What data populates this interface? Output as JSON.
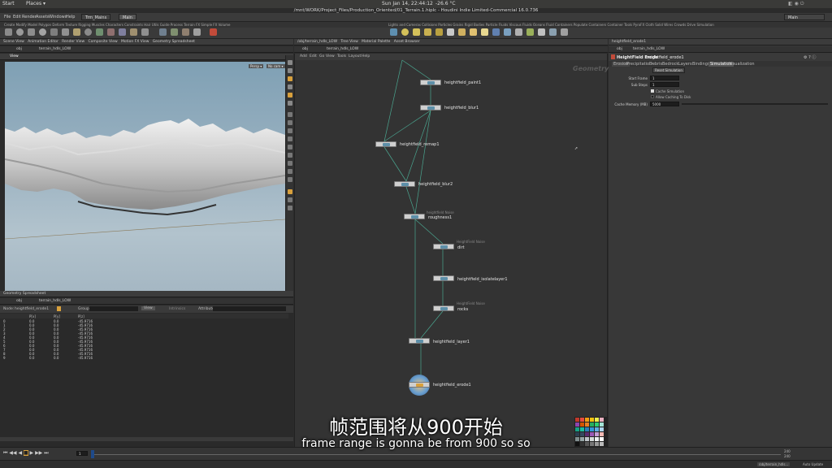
{
  "system": {
    "start": "Start",
    "places": "Places ▾",
    "datetime": "Sun Jan 14, 22:44:12",
    "temp": "-26.6 °C"
  },
  "window": {
    "title": "/mnt/WORK/Project_Files/Production_Oriented/01_Terrain.1.hiplc - Houdini Indie Limited-Commercial 16.0.736"
  },
  "menu": [
    "File",
    "Edit",
    "Render",
    "Assets",
    "Windows",
    "Help"
  ],
  "desktop_tabs": [
    "Trm_Mains",
    "Main"
  ],
  "desktop_right": "Main",
  "network_path": "obj",
  "network_node": "terrain_hdls_LOW",
  "network_menu": [
    "Add",
    "Edit",
    "Go",
    "View",
    "Tools",
    "Layout",
    "Help"
  ],
  "network_context": "Geometry",
  "viewport": {
    "tab": "View",
    "path": "obj",
    "node": "terrain_hdls_LOW",
    "persp": "Persp ▾",
    "cam": "No cam ▾"
  },
  "nodes": [
    {
      "name": "heightfield_paint1",
      "type": ""
    },
    {
      "name": "heightfield_blur1",
      "type": ""
    },
    {
      "name": "heightfield_remap1",
      "type": ""
    },
    {
      "name": "heightfield_blur2",
      "type": ""
    },
    {
      "name": "roughness1",
      "type": "heightfield Noise"
    },
    {
      "name": "dirt",
      "type": "HeightField Noise"
    },
    {
      "name": "heightfield_isolatelayer1",
      "type": ""
    },
    {
      "name": "rocks",
      "type": "HeightField Noise"
    },
    {
      "name": "heightfield_layer1",
      "type": ""
    },
    {
      "name": "heightfield_erode1",
      "type": ""
    }
  ],
  "params": {
    "path": "obj",
    "node_path": "terrain_hdls_LOW",
    "node_type": "HeightField Erode",
    "node_name": "heightfield_erode1",
    "tabs": [
      "Erosion",
      "Precipitation",
      "Debris",
      "Bedrock",
      "Layers",
      "Bindings",
      "Simulation",
      "Visualization"
    ],
    "reset_button": "Reset Simulation",
    "start_frame_label": "Start Frame",
    "start_frame": "1",
    "sub_steps_label": "Sub Steps",
    "sub_steps": "1",
    "cache_sim_label": "Cache Simulation",
    "allow_cache_label": "Allow Caching To Disk",
    "cache_mem_label": "Cache Memory (MB)",
    "cache_mem": "5000"
  },
  "spreadsheet": {
    "tab": "Geometry Spreadsheet",
    "node_label": "Node:",
    "node": "heightfield_erode1",
    "group_label": "Group:",
    "view": "View",
    "intrinsics": "Intrinsics",
    "attributes": "Attributes:",
    "columns": [
      "P[x]",
      "P[y]",
      "P[z]"
    ],
    "rows": [
      [
        "0",
        "0.0",
        "0.0",
        "-45.9716"
      ],
      [
        "1",
        "0.0",
        "0.0",
        "-45.9716"
      ],
      [
        "2",
        "0.0",
        "0.0",
        "-45.9716"
      ],
      [
        "3",
        "0.0",
        "0.0",
        "-45.9716"
      ],
      [
        "4",
        "0.0",
        "0.0",
        "-45.9716"
      ],
      [
        "5",
        "0.0",
        "0.0",
        "-45.9716"
      ],
      [
        "6",
        "0.0",
        "0.0",
        "-45.9716"
      ],
      [
        "7",
        "0.0",
        "0.0",
        "-45.9716"
      ],
      [
        "8",
        "0.0",
        "0.0",
        "-45.9716"
      ],
      [
        "9",
        "0.0",
        "0.0",
        "-45.9716"
      ]
    ]
  },
  "timeline": {
    "frame": "1",
    "start": "1",
    "end": "240",
    "end2": "240"
  },
  "status": {
    "path": "/obj/terrain_hdls...",
    "update": "Auto Update"
  },
  "subtitles": {
    "zh": "帧范围将从900开始",
    "en": "frame range is gonna be from 900 so so"
  },
  "colors": {
    "node_body": "#cfcfcf",
    "wire": "#4aa58f",
    "accent": "#e8a23c"
  }
}
